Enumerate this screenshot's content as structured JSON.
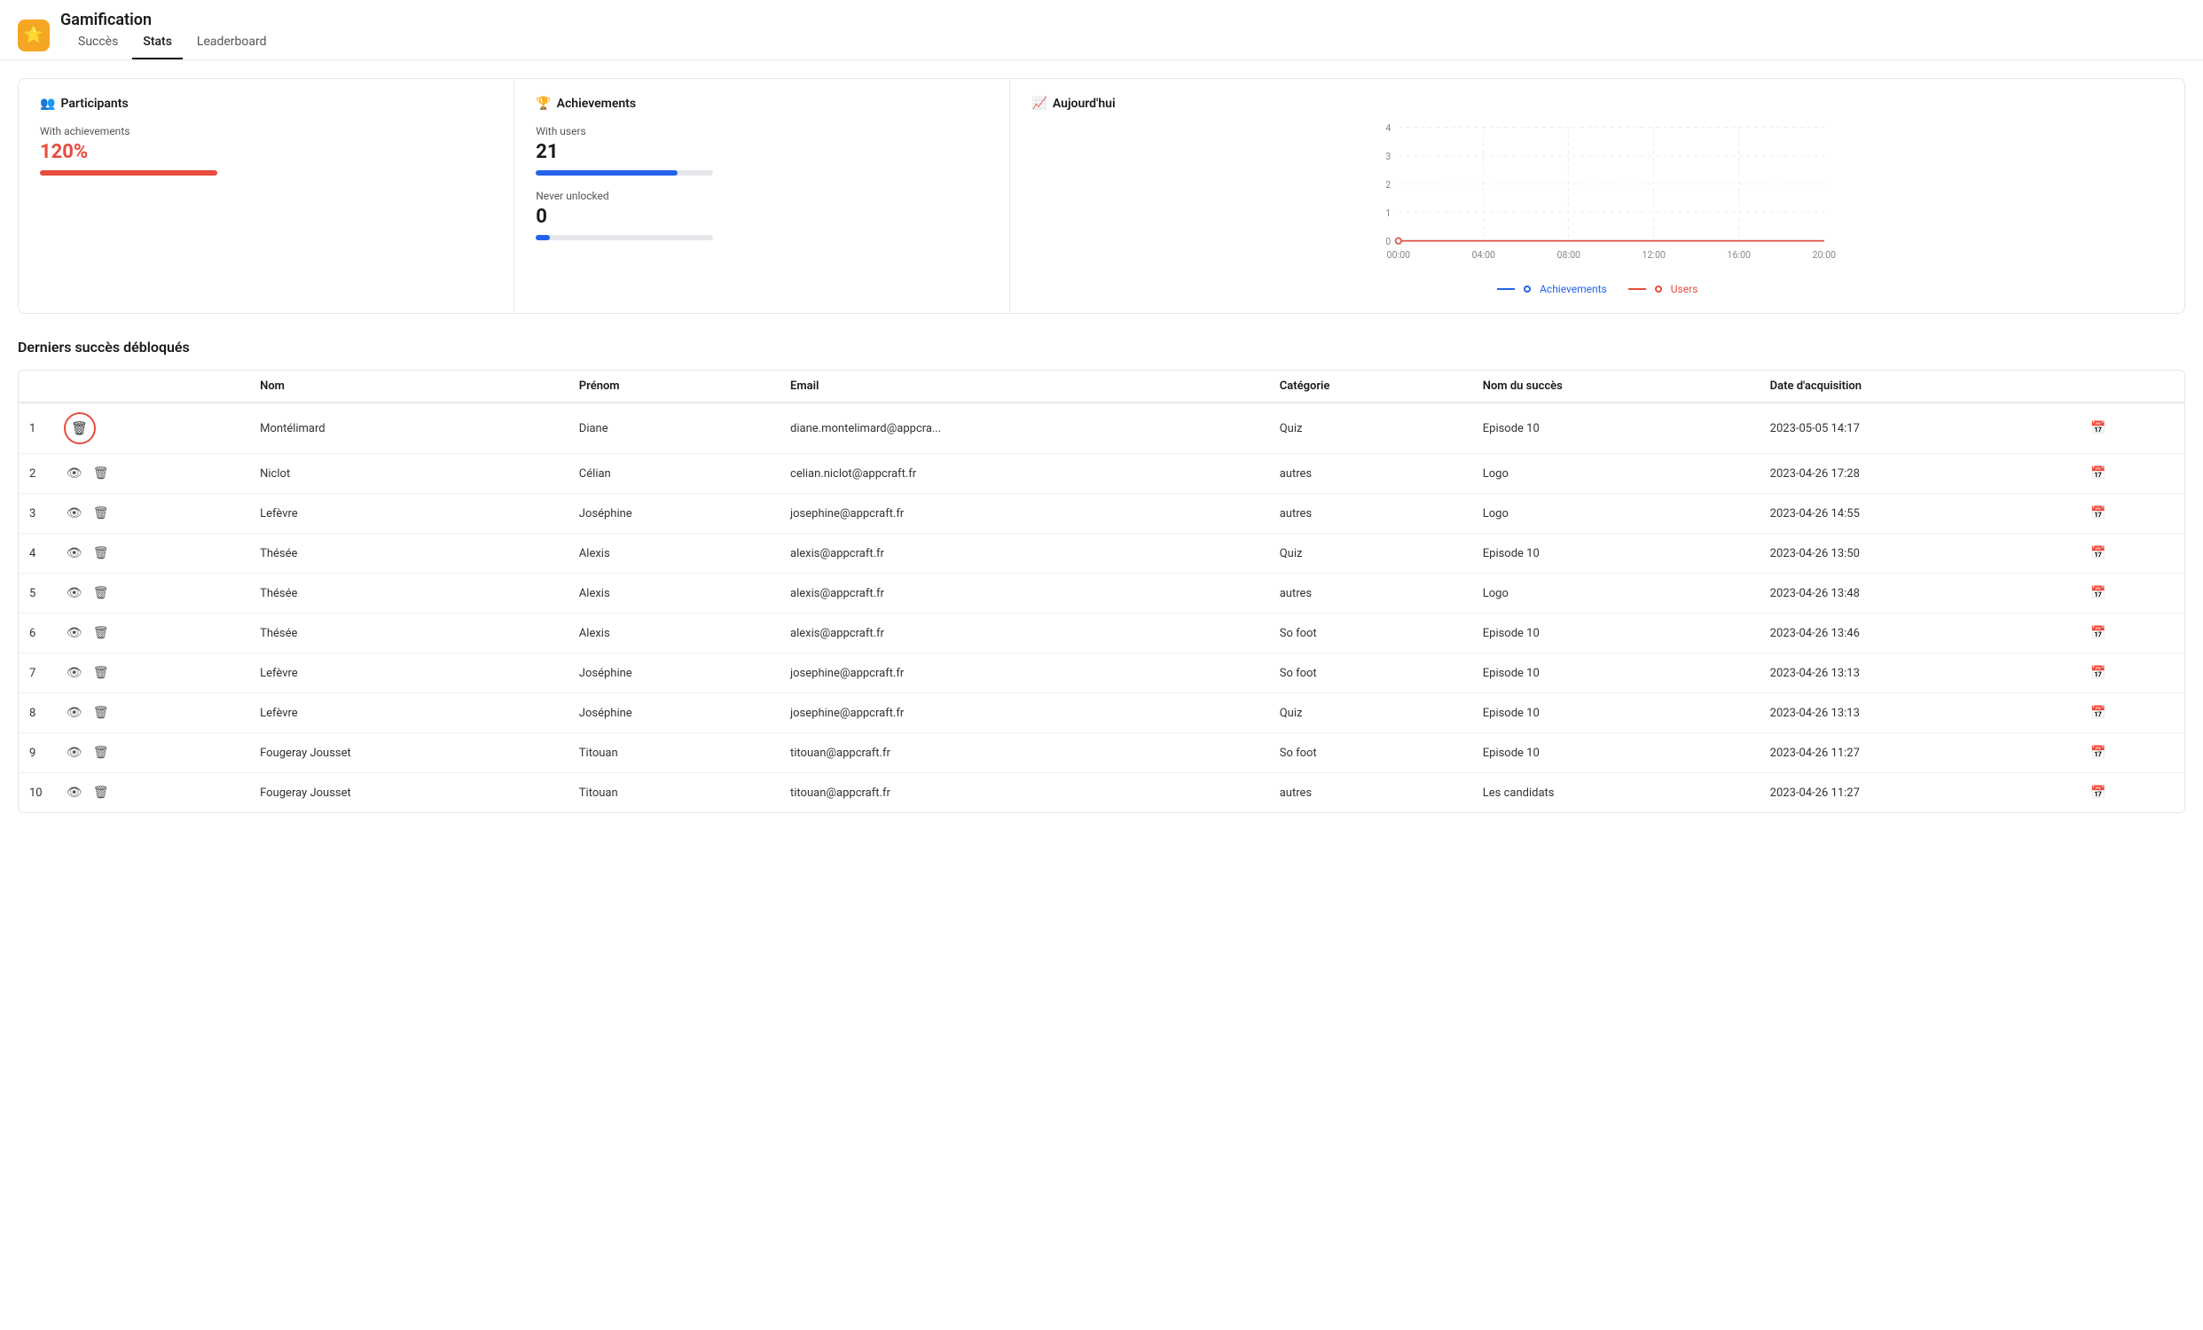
{
  "app": {
    "title": "Gamification",
    "icon": "⭐"
  },
  "nav": {
    "tabs": [
      {
        "id": "succes",
        "label": "Succès",
        "active": false
      },
      {
        "id": "stats",
        "label": "Stats",
        "active": true
      },
      {
        "id": "leaderboard",
        "label": "Leaderboard",
        "active": false
      }
    ]
  },
  "stats": {
    "participants": {
      "title": "Participants",
      "with_achievements_label": "With achievements",
      "with_achievements_value": "120%",
      "progress_color": "#e74c3c",
      "progress_percent": 100
    },
    "achievements": {
      "title": "Achievements",
      "with_users_label": "With users",
      "with_users_value": "21",
      "with_users_progress": 80,
      "with_users_color": "#2563eb",
      "never_unlocked_label": "Never unlocked",
      "never_unlocked_value": "0",
      "never_unlocked_progress": 8,
      "never_unlocked_color": "#2563eb"
    },
    "chart": {
      "title": "Aujourd'hui",
      "x_labels": [
        "00:00",
        "04:00",
        "08:00",
        "12:00",
        "16:00",
        "20:00"
      ],
      "y_labels": [
        "0",
        "1",
        "2",
        "3",
        "4"
      ],
      "legend_achievements_label": "Achievements",
      "legend_achievements_color": "#2563eb",
      "legend_users_label": "Users",
      "legend_users_color": "#e74c3c"
    }
  },
  "table": {
    "section_title": "Derniers succès débloqués",
    "columns": [
      "",
      "",
      "Nom",
      "Prénom",
      "Email",
      "Catégorie",
      "Nom du succès",
      "Date d'acquisition",
      ""
    ],
    "rows": [
      {
        "num": 1,
        "nom": "Montélimard",
        "prenom": "Diane",
        "email": "diane.montelimard@appcra...",
        "categorie": "Quiz",
        "nom_succes": "Episode 10",
        "date": "2023-05-05 14:17",
        "highlighted": true
      },
      {
        "num": 2,
        "nom": "Niclot",
        "prenom": "Célian",
        "email": "celian.niclot@appcraft.fr",
        "categorie": "autres",
        "nom_succes": "Logo",
        "date": "2023-04-26 17:28",
        "highlighted": false
      },
      {
        "num": 3,
        "nom": "Lefèvre",
        "prenom": "Joséphine",
        "email": "josephine@appcraft.fr",
        "categorie": "autres",
        "nom_succes": "Logo",
        "date": "2023-04-26 14:55",
        "highlighted": false
      },
      {
        "num": 4,
        "nom": "Thésée",
        "prenom": "Alexis",
        "email": "alexis@appcraft.fr",
        "categorie": "Quiz",
        "nom_succes": "Episode 10",
        "date": "2023-04-26 13:50",
        "highlighted": false
      },
      {
        "num": 5,
        "nom": "Thésée",
        "prenom": "Alexis",
        "email": "alexis@appcraft.fr",
        "categorie": "autres",
        "nom_succes": "Logo",
        "date": "2023-04-26 13:48",
        "highlighted": false
      },
      {
        "num": 6,
        "nom": "Thésée",
        "prenom": "Alexis",
        "email": "alexis@appcraft.fr",
        "categorie": "So foot",
        "nom_succes": "Episode 10",
        "date": "2023-04-26 13:46",
        "highlighted": false
      },
      {
        "num": 7,
        "nom": "Lefèvre",
        "prenom": "Joséphine",
        "email": "josephine@appcraft.fr",
        "categorie": "So foot",
        "nom_succes": "Episode 10",
        "date": "2023-04-26 13:13",
        "highlighted": false
      },
      {
        "num": 8,
        "nom": "Lefèvre",
        "prenom": "Joséphine",
        "email": "josephine@appcraft.fr",
        "categorie": "Quiz",
        "nom_succes": "Episode 10",
        "date": "2023-04-26 13:13",
        "highlighted": false
      },
      {
        "num": 9,
        "nom": "Fougeray Jousset",
        "prenom": "Titouan",
        "email": "titouan@appcraft.fr",
        "categorie": "So foot",
        "nom_succes": "Episode 10",
        "date": "2023-04-26 11:27",
        "highlighted": false
      },
      {
        "num": 10,
        "nom": "Fougeray Jousset",
        "prenom": "Titouan",
        "email": "titouan@appcraft.fr",
        "categorie": "autres",
        "nom_succes": "Les candidats",
        "date": "2023-04-26 11:27",
        "highlighted": false
      }
    ]
  }
}
